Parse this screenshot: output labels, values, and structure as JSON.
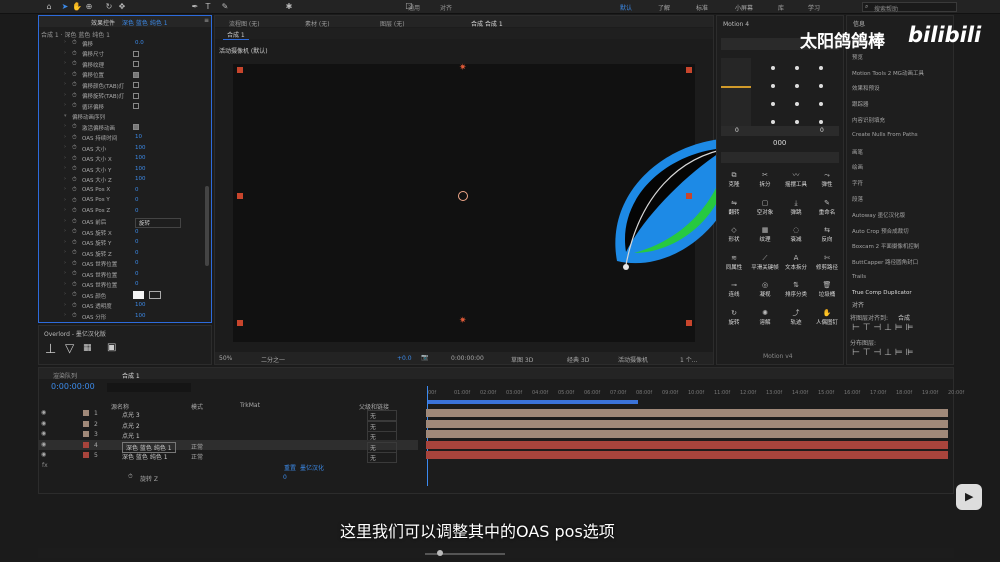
{
  "toolbar": {
    "search_placeholder": "搜索帮助",
    "snap_label": "对齐",
    "align_label": "通用",
    "workspace_tabs": [
      "默认",
      "了解",
      "标准",
      "小屏幕",
      "库",
      "学习"
    ]
  },
  "effect_panel": {
    "tab_label": "效果控件",
    "tab_layer": "深色 蓝色 纯色 1",
    "breadcrumb": "合成 1 · 深色 蓝色 纯色 1",
    "rows": [
      {
        "label": "偏移",
        "type": "val",
        "value": "0.0"
      },
      {
        "label": "偏移尺寸",
        "type": "cb"
      },
      {
        "label": "偏移纹理",
        "type": "cb"
      },
      {
        "label": "偏移位置",
        "type": "cb_on"
      },
      {
        "label": "偏移颜色(TAB)灯",
        "type": "cb"
      },
      {
        "label": "偏移旋转(TAB)灯",
        "type": "cb"
      },
      {
        "label": "循环偏移",
        "type": "cb"
      },
      {
        "label": "偏移动画序列",
        "type": "group"
      },
      {
        "label": "激活偏移动画",
        "type": "cb_on"
      },
      {
        "label": "OAS 持续时间",
        "type": "val",
        "value": "10"
      },
      {
        "label": "OAS 大小",
        "type": "val",
        "value": "100"
      },
      {
        "label": "OAS 大小 X",
        "type": "val",
        "value": "100"
      },
      {
        "label": "OAS 大小 Y",
        "type": "val",
        "value": "100"
      },
      {
        "label": "OAS 大小 Z",
        "type": "val",
        "value": "100"
      },
      {
        "label": "OAS Pos X",
        "type": "val",
        "value": "0"
      },
      {
        "label": "OAS Pos Y",
        "type": "val",
        "value": "0"
      },
      {
        "label": "OAS Pos Z",
        "type": "val",
        "value": "0"
      },
      {
        "label": "OAS 前后",
        "type": "select",
        "value": "旋转"
      },
      {
        "label": "OAS 旋转 X",
        "type": "val",
        "value": "0"
      },
      {
        "label": "OAS 旋转 Y",
        "type": "val",
        "value": "0"
      },
      {
        "label": "OAS 旋转 Z",
        "type": "val",
        "value": "0"
      },
      {
        "label": "OAS 世界位置",
        "type": "val",
        "value": "0"
      },
      {
        "label": "OAS 世界位置",
        "type": "val",
        "value": "0"
      },
      {
        "label": "OAS 世界位置",
        "type": "val",
        "value": "0"
      },
      {
        "label": "OAS 颜色",
        "type": "color"
      },
      {
        "label": "OAS 透明度",
        "type": "val",
        "value": "100"
      },
      {
        "label": "OAS 分形",
        "type": "val",
        "value": "100"
      }
    ]
  },
  "overlord": {
    "title": "Overlord - 墨亿汉化版"
  },
  "viewer": {
    "tabs": [
      "流程图 (无)",
      "素材 (无)",
      "图层 (无)"
    ],
    "comp_tab": "合成 合成 1",
    "sub_tab": "合成 1",
    "camera_label": "活动摄像机 (默认)",
    "bottom": {
      "zoom": "50%",
      "res": "二分之一",
      "timecode": "0:00:00:00",
      "exposure": "+0.0",
      "renderer": "草图 3D",
      "view": "经典 3D",
      "camera": "活动摄像机",
      "views": "1 个..."
    }
  },
  "motion": {
    "title": "Motion 4",
    "values": [
      "0",
      "0"
    ],
    "counter": "000",
    "buttons": [
      [
        "克隆",
        "拆分",
        "摇摆工具",
        "弹性"
      ],
      [
        "翻转",
        "空对象",
        "弹跳",
        "重命名"
      ],
      [
        "形状",
        "纹理",
        "衰减",
        "反向"
      ],
      [
        "同属性",
        "平滑关键帧",
        "文本拆分",
        "修剪路径"
      ],
      [
        "连线",
        "凝视",
        "排序分类",
        "垃圾桶"
      ],
      [
        "旋转",
        "溶解",
        "轨迹",
        "人偶图钉"
      ]
    ],
    "footer": "Motion v4"
  },
  "right_panel": {
    "header": "信息",
    "items": [
      "音频",
      "预览",
      "Motion Tools 2 MG动画工具",
      "效果和预设",
      "跟踪器",
      "内容识别填充",
      "Create Nulls From Paths",
      "画笔",
      "绘画",
      "字符",
      "段落",
      "Autoway 墨亿汉化版",
      "Auto Crop 预合成裁切",
      "Boxcam 2 平面摄像机控制",
      "ButtCapper 路径圆角封口",
      "Trails",
      "True Comp Duplicator"
    ],
    "align": {
      "title": "对齐",
      "align_to_label": "将图层对齐到:",
      "align_to_value": "合成",
      "distribute_label": "分布图层:"
    }
  },
  "watermark": {
    "text": "太阳鸽鸽棒",
    "brand": "bilibili"
  },
  "timeline": {
    "queue_tab": "渲染队列",
    "comp_tab": "合成 1",
    "timecode": "0:00:00:00",
    "headers": {
      "source": "源名称",
      "mode": "模式",
      "trkmat": "TrkMat",
      "parent": "父级和链接"
    },
    "ruler": [
      "00f",
      "01:00f",
      "02:00f",
      "03:00f",
      "04:00f",
      "05:00f",
      "06:00f",
      "07:00f",
      "08:00f",
      "09:00f",
      "10:00f",
      "11:00f",
      "12:00f",
      "13:00f",
      "14:00f",
      "15:00f",
      "16:00f",
      "17:00f",
      "18:00f",
      "19:00f",
      "20:00f"
    ],
    "layers": [
      {
        "num": "1",
        "name": "点光 3",
        "mode": "",
        "parent": "无"
      },
      {
        "num": "2",
        "name": "点光 2",
        "mode": "",
        "parent": "无"
      },
      {
        "num": "3",
        "name": "点光 1",
        "mode": "",
        "parent": "无"
      },
      {
        "num": "4",
        "name": "深色 蓝色 纯色 1",
        "mode": "正常",
        "parent": "无"
      },
      {
        "num": "5",
        "name": "深色 蓝色 纯色 1",
        "mode": "正常",
        "parent": "无"
      }
    ],
    "sub_label": "fx",
    "sub_item": "旋转 Z",
    "sub_value": "0",
    "reset_label": "重置",
    "expr_label": "墨亿汉化"
  },
  "subtitle": "这里我们可以调整其中的OAS pos选项",
  "colors": {
    "accent": "#2d6bdc",
    "layer_light": "#a08979",
    "layer_red": "#a8443c"
  }
}
